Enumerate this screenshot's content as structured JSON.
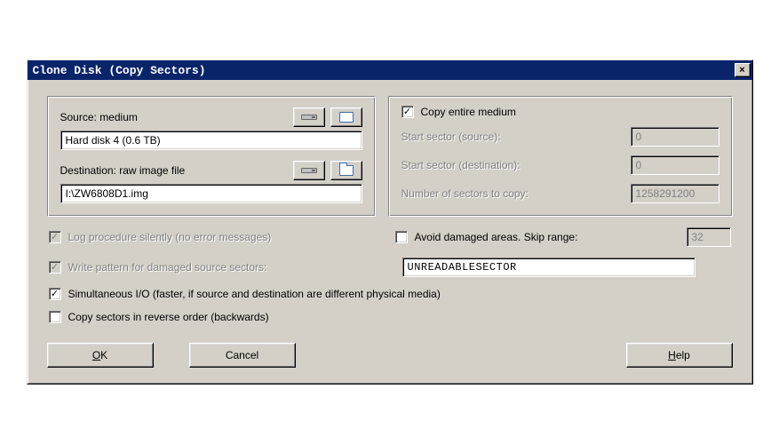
{
  "title": "Clone Disk (Copy Sectors)",
  "close_label": "×",
  "source": {
    "label": "Source: medium",
    "value": "Hard disk 4 (0.6 TB)"
  },
  "destination": {
    "label": "Destination: raw image file",
    "value": "I:\\ZW6808D1.img"
  },
  "right": {
    "copy_entire": "Copy entire medium",
    "start_source_label": "Start sector (source):",
    "start_source_value": "0",
    "start_dest_label": "Start sector (destination):",
    "start_dest_value": "0",
    "num_sectors_label": "Number of sectors to copy:",
    "num_sectors_value": "1258291200"
  },
  "options": {
    "log_silent": "Log procedure silently (no error messages)",
    "avoid_damaged": "Avoid damaged areas. Skip range:",
    "skip_range": "32",
    "write_pattern": "Write pattern for damaged source sectors:",
    "pattern_value": "UNREADABLESECTOR",
    "simul_io": "Simultaneous I/O (faster, if source and destination are different physical media)",
    "reverse": "Copy sectors in reverse order (backwards)"
  },
  "buttons": {
    "ok": "OK",
    "ok_u": "O",
    "ok_rest": "K",
    "cancel": "Cancel",
    "help": "Help",
    "help_u": "H",
    "help_rest": "elp"
  }
}
